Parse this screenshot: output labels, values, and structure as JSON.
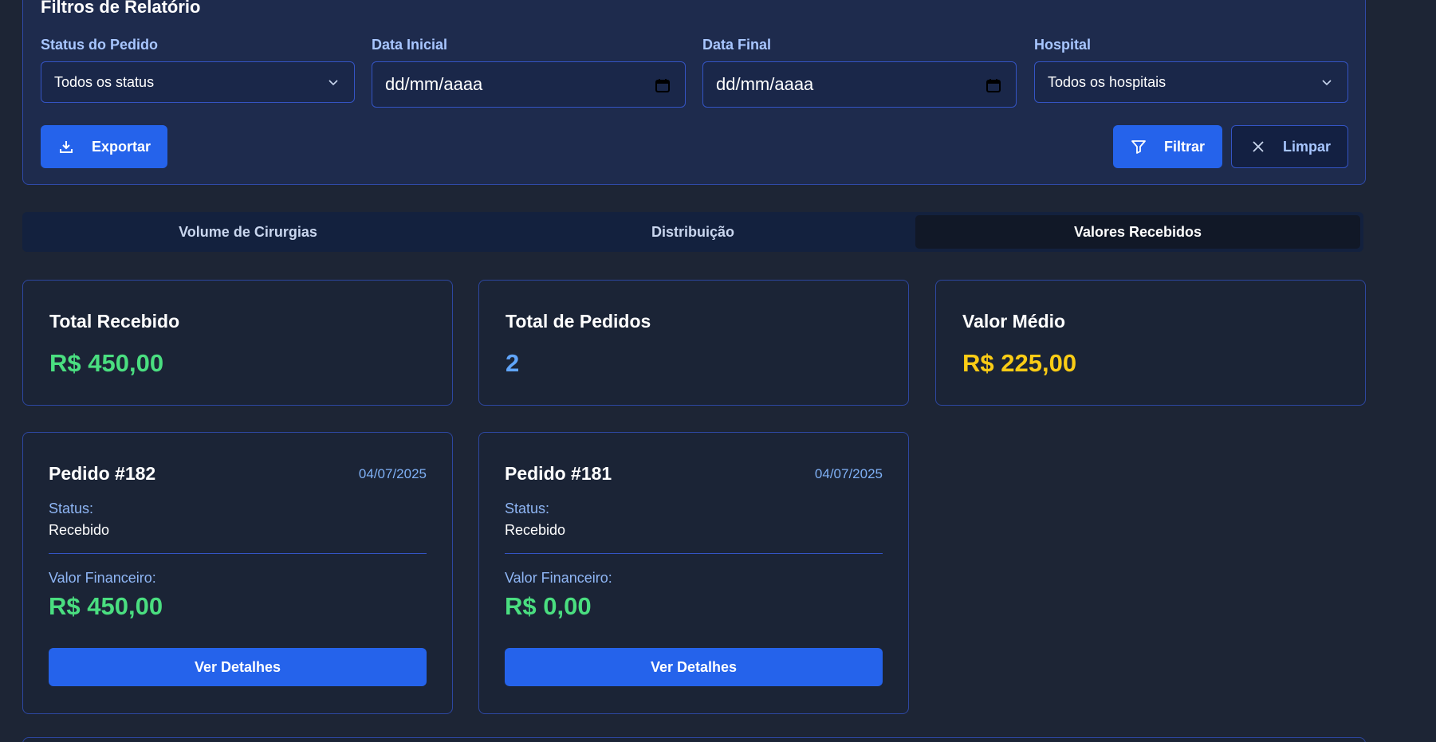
{
  "filters": {
    "title": "Filtros de Relatório",
    "status": {
      "label": "Status do Pedido",
      "value": "Todos os status"
    },
    "start_date": {
      "label": "Data Inicial",
      "value": "dd/mm/aaaa"
    },
    "end_date": {
      "label": "Data Final",
      "value": "dd/mm/aaaa"
    },
    "hospital": {
      "label": "Hospital",
      "value": "Todos os hospitais"
    },
    "export_label": "Exportar",
    "filter_label": "Filtrar",
    "clear_label": "Limpar"
  },
  "tabs": [
    {
      "label": "Volume de Cirurgias",
      "active": false
    },
    {
      "label": "Distribuição",
      "active": false
    },
    {
      "label": "Valores Recebidos",
      "active": true
    }
  ],
  "summary": [
    {
      "title": "Total Recebido",
      "value": "R$ 450,00",
      "color": "#4ade80"
    },
    {
      "title": "Total de Pedidos",
      "value": "2",
      "color": "#60a5fa"
    },
    {
      "title": "Valor Médio",
      "value": "R$ 225,00",
      "color": "#facc15"
    }
  ],
  "orders": [
    {
      "title": "Pedido #182",
      "date": "04/07/2025",
      "status_label": "Status:",
      "status": "Recebido",
      "value_label": "Valor Financeiro:",
      "value": "R$ 450,00",
      "button": "Ver Detalhes"
    },
    {
      "title": "Pedido #181",
      "date": "04/07/2025",
      "status_label": "Status:",
      "status": "Recebido",
      "value_label": "Valor Financeiro:",
      "value": "R$ 0,00",
      "button": "Ver Detalhes"
    }
  ],
  "colors": {
    "background": "#1d2535",
    "accent": "#2563eb",
    "positive": "#4ade80",
    "info": "#60a5fa",
    "warning": "#facc15"
  }
}
